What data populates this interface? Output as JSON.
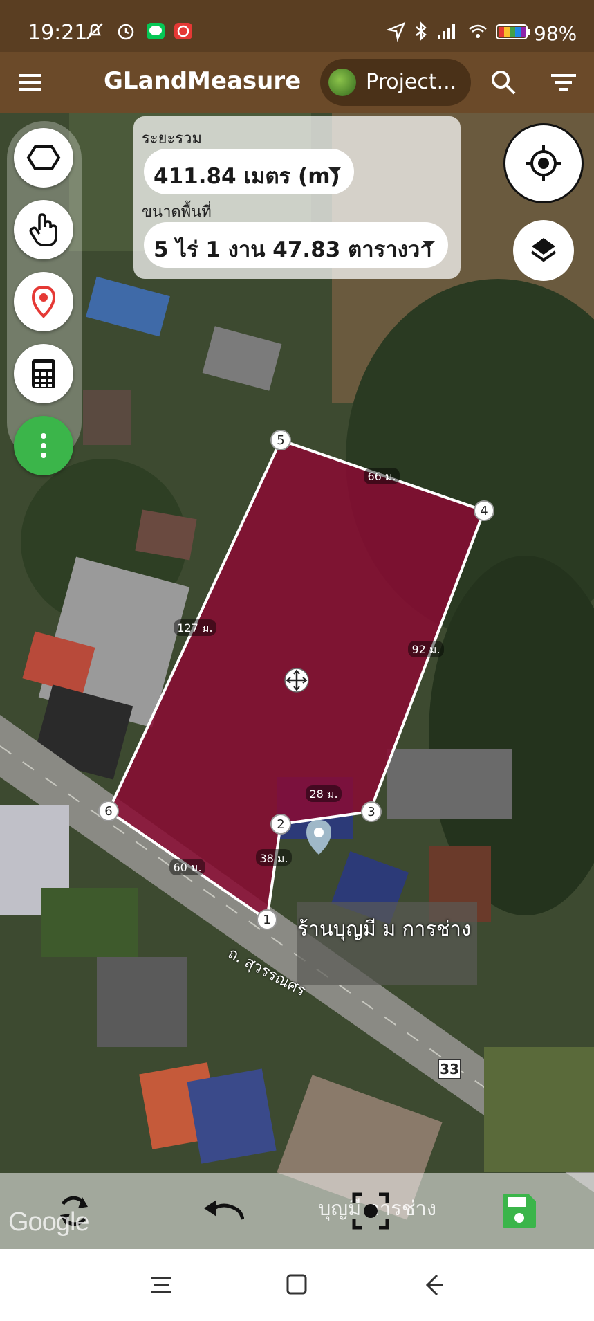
{
  "status_bar": {
    "time": "19:21",
    "battery": "98%",
    "icons": [
      "mute-icon",
      "alarm-icon",
      "line-icon",
      "app-notification-icon",
      "location-icon",
      "bluetooth-icon",
      "signal-icon",
      "wifi-icon",
      "battery-icon"
    ]
  },
  "app_bar": {
    "title": "GLandMeasure",
    "project_label": "Project...",
    "icons": [
      "menu-icon",
      "search-icon",
      "filter-icon"
    ]
  },
  "measure": {
    "distance_label": "ระยะรวม",
    "distance_value": "411.84 เมตร (m)",
    "area_label": "ขนาดพื้นที่",
    "area_value": "5 ไร่ 1 งาน 47.83 ตารางวา"
  },
  "toolbar": {
    "tools": [
      "polygon-icon",
      "touch-icon",
      "location-pin-icon",
      "calculator-icon",
      "more-icon"
    ]
  },
  "map": {
    "polygon_color": "#8a0a33",
    "vertices": [
      "1",
      "2",
      "3",
      "4",
      "5",
      "6"
    ],
    "edge_labels": [
      "38 ม.",
      "28 ม.",
      "92 ม.",
      "66 ม.",
      "127 ม.",
      "60 ม."
    ],
    "place_name": "ร้านบุญมี ม การช่าง",
    "road_name": "ถ. สุวรรณศร",
    "route_number": "33",
    "google": "Google"
  },
  "bottom_bar": {
    "place_label": "บุญมี การช่าง",
    "icons": [
      "refresh-icon",
      "undo-icon",
      "screenshot-icon",
      "save-icon"
    ],
    "save_color": "#3bb54a"
  },
  "nav_bar": {
    "icons": [
      "recent-apps-icon",
      "home-icon",
      "back-icon"
    ]
  }
}
